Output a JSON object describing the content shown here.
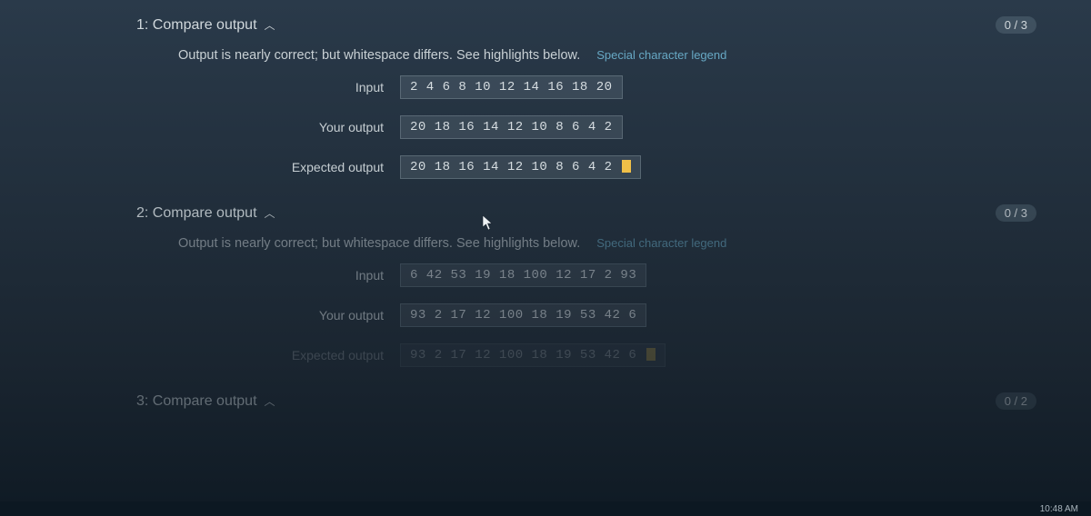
{
  "sections": [
    {
      "title": "1: Compare output",
      "score": "0 / 3",
      "message": "Output is nearly correct; but whitespace differs. See highlights below.",
      "legend": "Special character legend",
      "rows": {
        "input_label": "Input",
        "input_value": "2 4 6 8 10 12 14 16 18 20",
        "your_label": "Your output",
        "your_value": "20 18 16 14 12 10 8 6 4 2",
        "expected_label": "Expected output",
        "expected_value": "20 18 16 14 12 10 8 6 4 2 "
      }
    },
    {
      "title": "2: Compare output",
      "score": "0 / 3",
      "message": "Output is nearly correct; but whitespace differs. See highlights below.",
      "legend": "Special character legend",
      "rows": {
        "input_label": "Input",
        "input_value": "6 42 53 19 18 100 12 17 2 93",
        "your_label": "Your output",
        "your_value": "93 2 17 12 100 18 19 53 42 6",
        "expected_label": "Expected output",
        "expected_value": "93 2 17 12 100 18 19 53 42 6 "
      }
    },
    {
      "title": "3: Compare output",
      "score": "0 / 2"
    }
  ],
  "clock": "10:48 AM"
}
